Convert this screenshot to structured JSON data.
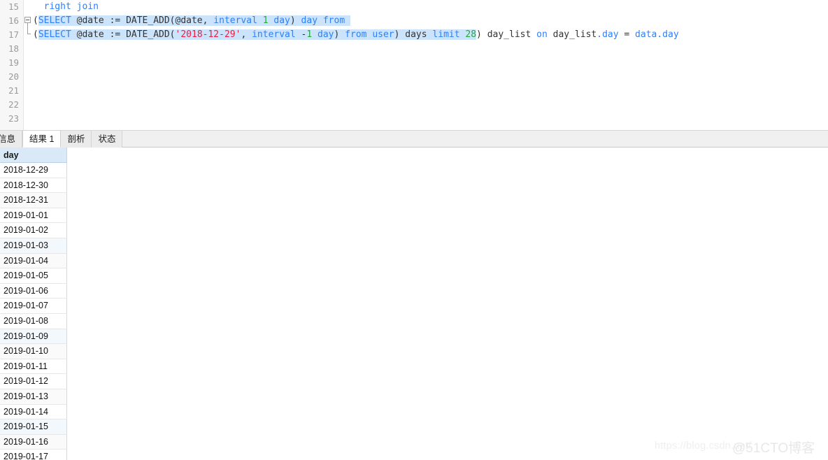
{
  "editor": {
    "gutter_lines": [
      "15",
      "16",
      "17",
      "18",
      "19",
      "20",
      "21",
      "22",
      "23"
    ],
    "fold_marker": "collapse-fold-icon",
    "lines": [
      {
        "number": "15",
        "text": "  right join",
        "tokens": [
          {
            "t": "  ",
            "c": "plain",
            "sel": false
          },
          {
            "t": "right join",
            "c": "kw",
            "sel": false
          }
        ]
      },
      {
        "number": "16",
        "text": "(SELECT @date := DATE_ADD(@date, interval 1 day) day from",
        "tokens": [
          {
            "t": "(",
            "c": "plain",
            "sel": false
          },
          {
            "t": "SELECT",
            "c": "kw",
            "sel": true
          },
          {
            "t": " @date := DATE_ADD(@date, ",
            "c": "plain",
            "sel": true
          },
          {
            "t": "interval",
            "c": "kw",
            "sel": true
          },
          {
            "t": " ",
            "c": "plain",
            "sel": true
          },
          {
            "t": "1",
            "c": "num",
            "sel": true
          },
          {
            "t": " ",
            "c": "plain",
            "sel": true
          },
          {
            "t": "day",
            "c": "kw",
            "sel": true
          },
          {
            "t": ") ",
            "c": "plain",
            "sel": true
          },
          {
            "t": "day",
            "c": "kw",
            "sel": true
          },
          {
            "t": " ",
            "c": "plain",
            "sel": true
          },
          {
            "t": "from",
            "c": "kw",
            "sel": true
          },
          {
            "t": " ",
            "c": "plain",
            "sel": true
          }
        ]
      },
      {
        "number": "17",
        "text": "(SELECT @date := DATE_ADD('2018-12-29', interval -1 day) from user) days limit 28) day_list on day_list.day = data.day",
        "tokens": [
          {
            "t": "(",
            "c": "plain",
            "sel": false
          },
          {
            "t": "SELECT",
            "c": "kw",
            "sel": true
          },
          {
            "t": " @date := DATE_ADD(",
            "c": "plain",
            "sel": true
          },
          {
            "t": "'2018-12-29'",
            "c": "str",
            "sel": true
          },
          {
            "t": ", ",
            "c": "plain",
            "sel": true
          },
          {
            "t": "interval",
            "c": "kw",
            "sel": true
          },
          {
            "t": " -",
            "c": "plain",
            "sel": true
          },
          {
            "t": "1",
            "c": "num",
            "sel": true
          },
          {
            "t": " ",
            "c": "plain",
            "sel": true
          },
          {
            "t": "day",
            "c": "kw",
            "sel": true
          },
          {
            "t": ") ",
            "c": "plain",
            "sel": true
          },
          {
            "t": "from",
            "c": "kw",
            "sel": true
          },
          {
            "t": " ",
            "c": "plain",
            "sel": true
          },
          {
            "t": "user",
            "c": "kw",
            "sel": true
          },
          {
            "t": ") days ",
            "c": "plain",
            "sel": true
          },
          {
            "t": "limit",
            "c": "kw",
            "sel": true
          },
          {
            "t": " ",
            "c": "plain",
            "sel": true
          },
          {
            "t": "28",
            "c": "num",
            "sel": true
          },
          {
            "t": ") day_list ",
            "c": "plain",
            "sel": false
          },
          {
            "t": "on",
            "c": "kw",
            "sel": false
          },
          {
            "t": " day_list",
            "c": "plain",
            "sel": false
          },
          {
            "t": ".day",
            "c": "kw",
            "sel": false
          },
          {
            "t": " = ",
            "c": "plain",
            "sel": false
          },
          {
            "t": "data",
            "c": "kw",
            "sel": false
          },
          {
            "t": ".day",
            "c": "kw",
            "sel": false
          }
        ]
      }
    ]
  },
  "tabs": [
    {
      "label": "信息",
      "active": false
    },
    {
      "label": "结果 1",
      "active": true
    },
    {
      "label": "剖析",
      "active": false
    },
    {
      "label": "状态",
      "active": false
    }
  ],
  "grid": {
    "column_header": "day",
    "rows": [
      "2018-12-29",
      "2018-12-30",
      "2018-12-31",
      "2019-01-01",
      "2019-01-02",
      "2019-01-03",
      "2019-01-04",
      "2019-01-05",
      "2019-01-06",
      "2019-01-07",
      "2019-01-08",
      "2019-01-09",
      "2019-01-10",
      "2019-01-11",
      "2019-01-12",
      "2019-01-13",
      "2019-01-14",
      "2019-01-15",
      "2019-01-16",
      "2019-01-17"
    ]
  },
  "watermark": {
    "url": "https://blog.csdn.net/",
    "brand": "@51CTO博客"
  },
  "colors": {
    "keyword": "#2d7ff9",
    "number": "#22a83a",
    "string": "#ee1c44",
    "selection": "#cbe4fb",
    "grid_header_bg": "#d9e9f7"
  }
}
